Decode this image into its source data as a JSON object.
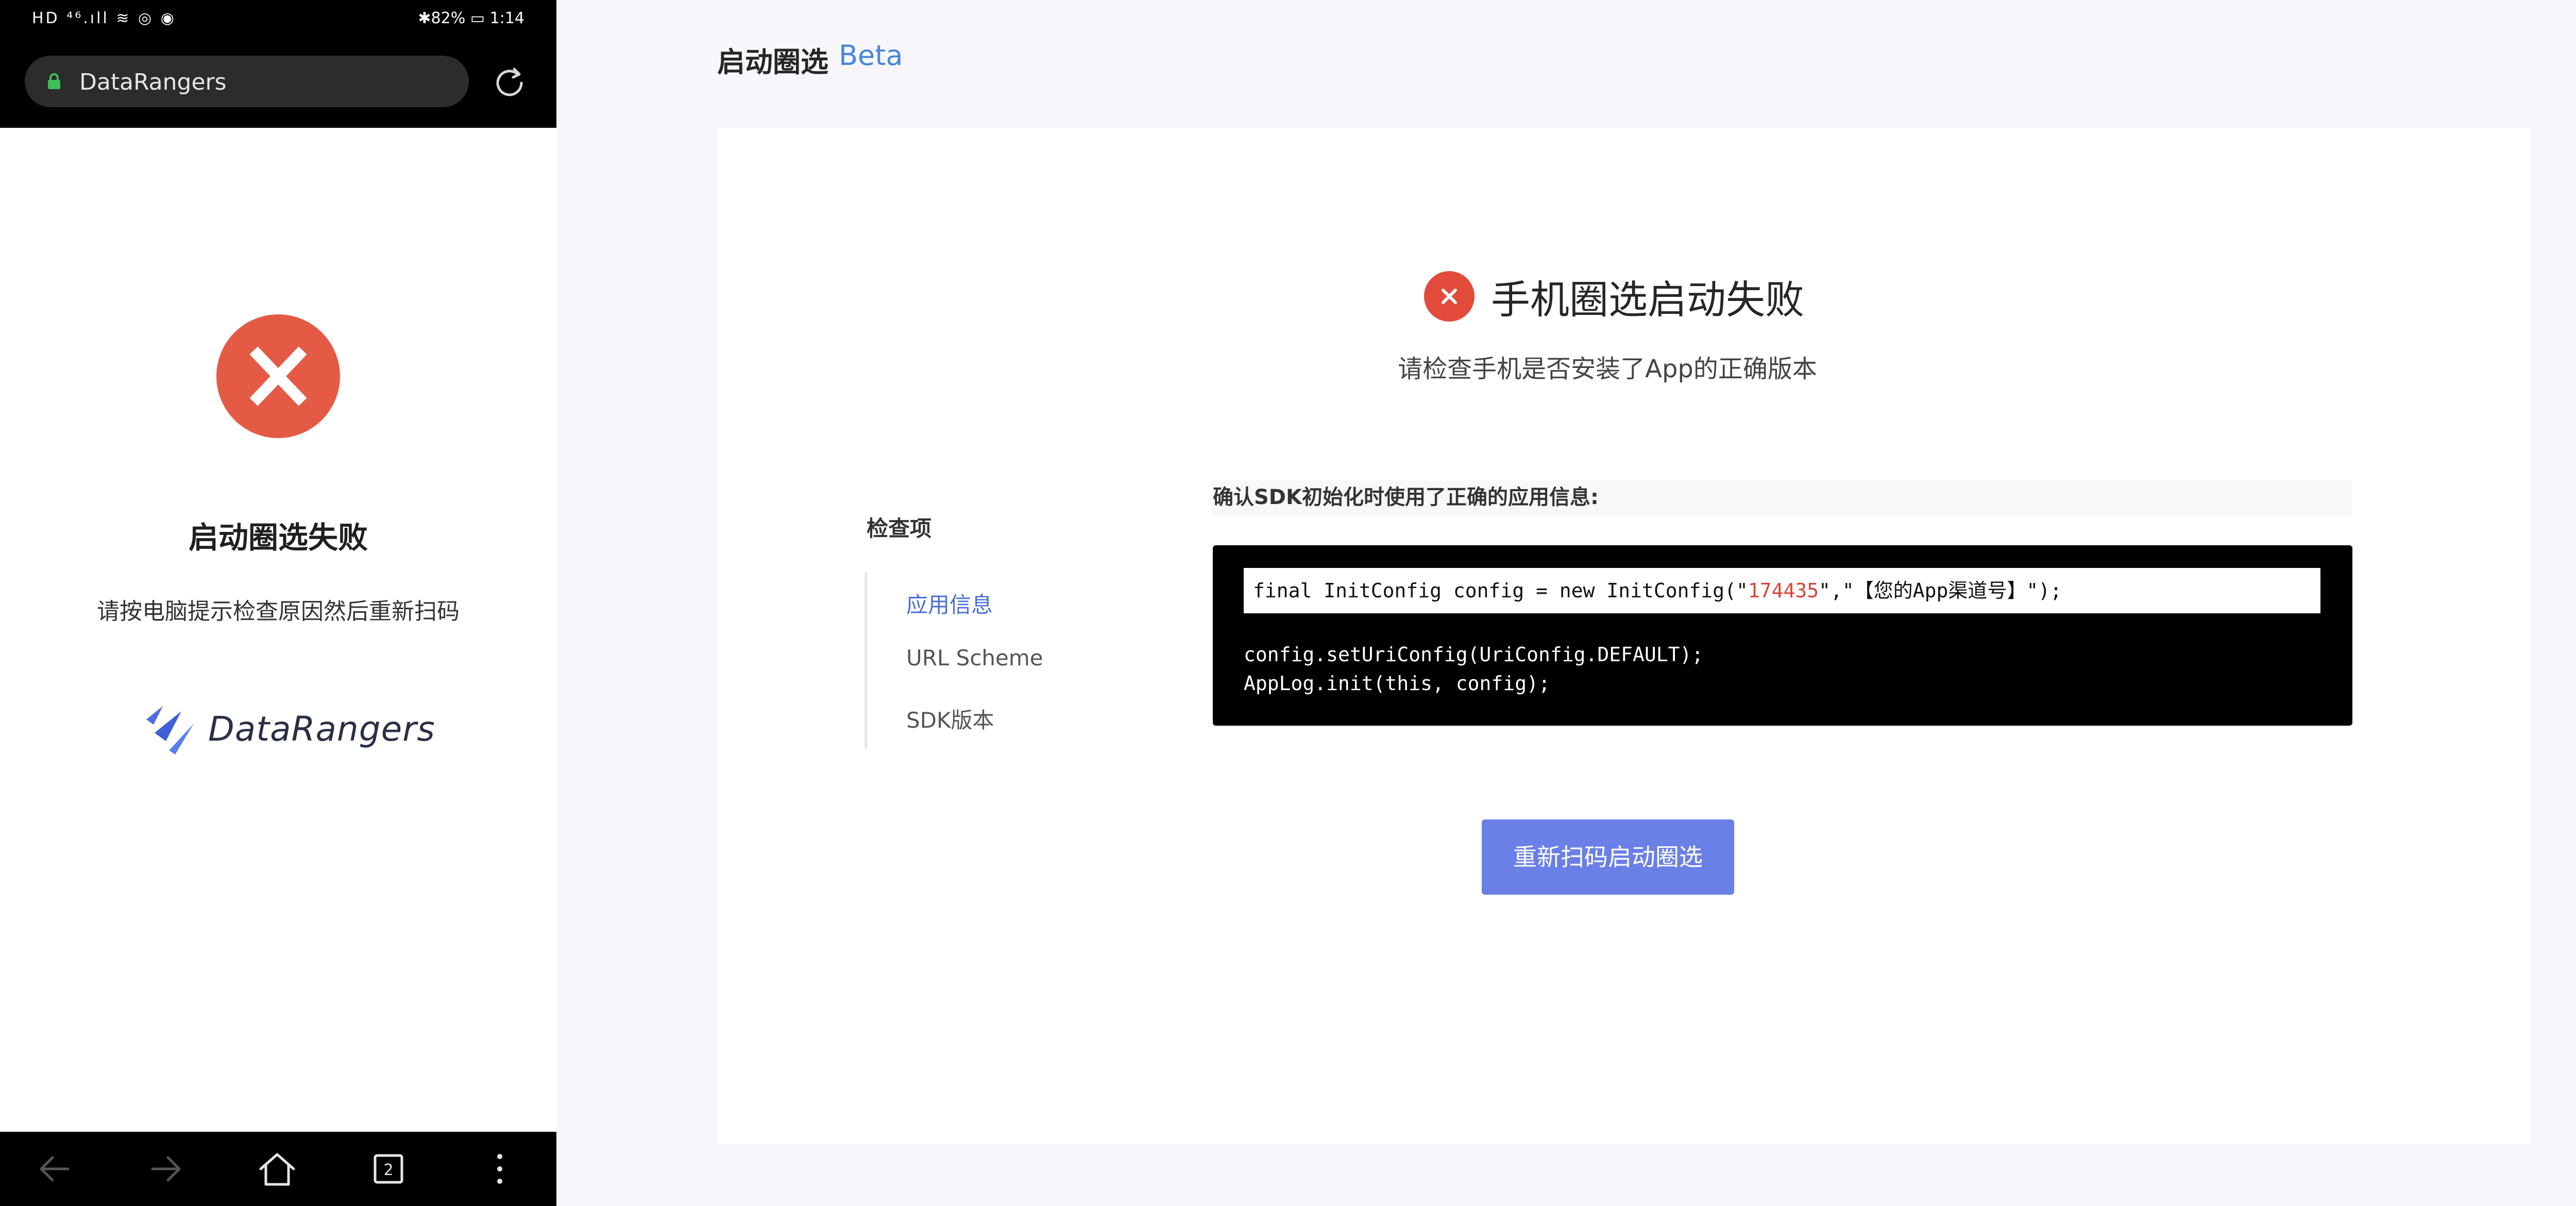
{
  "phone": {
    "status_left": "HD ⁴⁶.ıll ≋ ◎ ◉",
    "status_right": "✱82% ▭ 1:14",
    "url": "DataRangers",
    "fail_title": "启动圈选失败",
    "fail_subtitle": "请按电脑提示检查原因然后重新扫码",
    "logo_text": "DataRangers",
    "tab_count": "2",
    "icons": [
      "lock-icon",
      "reload-icon",
      "error-x-icon",
      "back-icon",
      "forward-icon",
      "home-icon",
      "tabs-icon",
      "menu-icon"
    ]
  },
  "desktop": {
    "page_title": "启动圈选",
    "beta": "Beta",
    "error_title": "手机圈选启动失败",
    "error_subtitle": "请检查手机是否安装了App的正确版本",
    "check_label": "检查项",
    "check_items": [
      "应用信息",
      "URL Scheme",
      "SDK版本"
    ],
    "code_heading": "确认SDK初始化时使用了正确的应用信息:",
    "code": {
      "line1_pre": "final InitConfig config = new InitConfig(\"",
      "line1_app_id": "174435",
      "line1_post": "\",\"【您的App渠道号】\");",
      "line2": "config.setUriConfig(UriConfig.DEFAULT);",
      "line3": "AppLog.init(this, config);"
    },
    "rescan_button": "重新扫码启动圈选"
  },
  "colors": {
    "accent": "#6a80e6",
    "active_item": "#4a6ed6",
    "error": "#e24b3b",
    "beta": "#4a86d8"
  }
}
